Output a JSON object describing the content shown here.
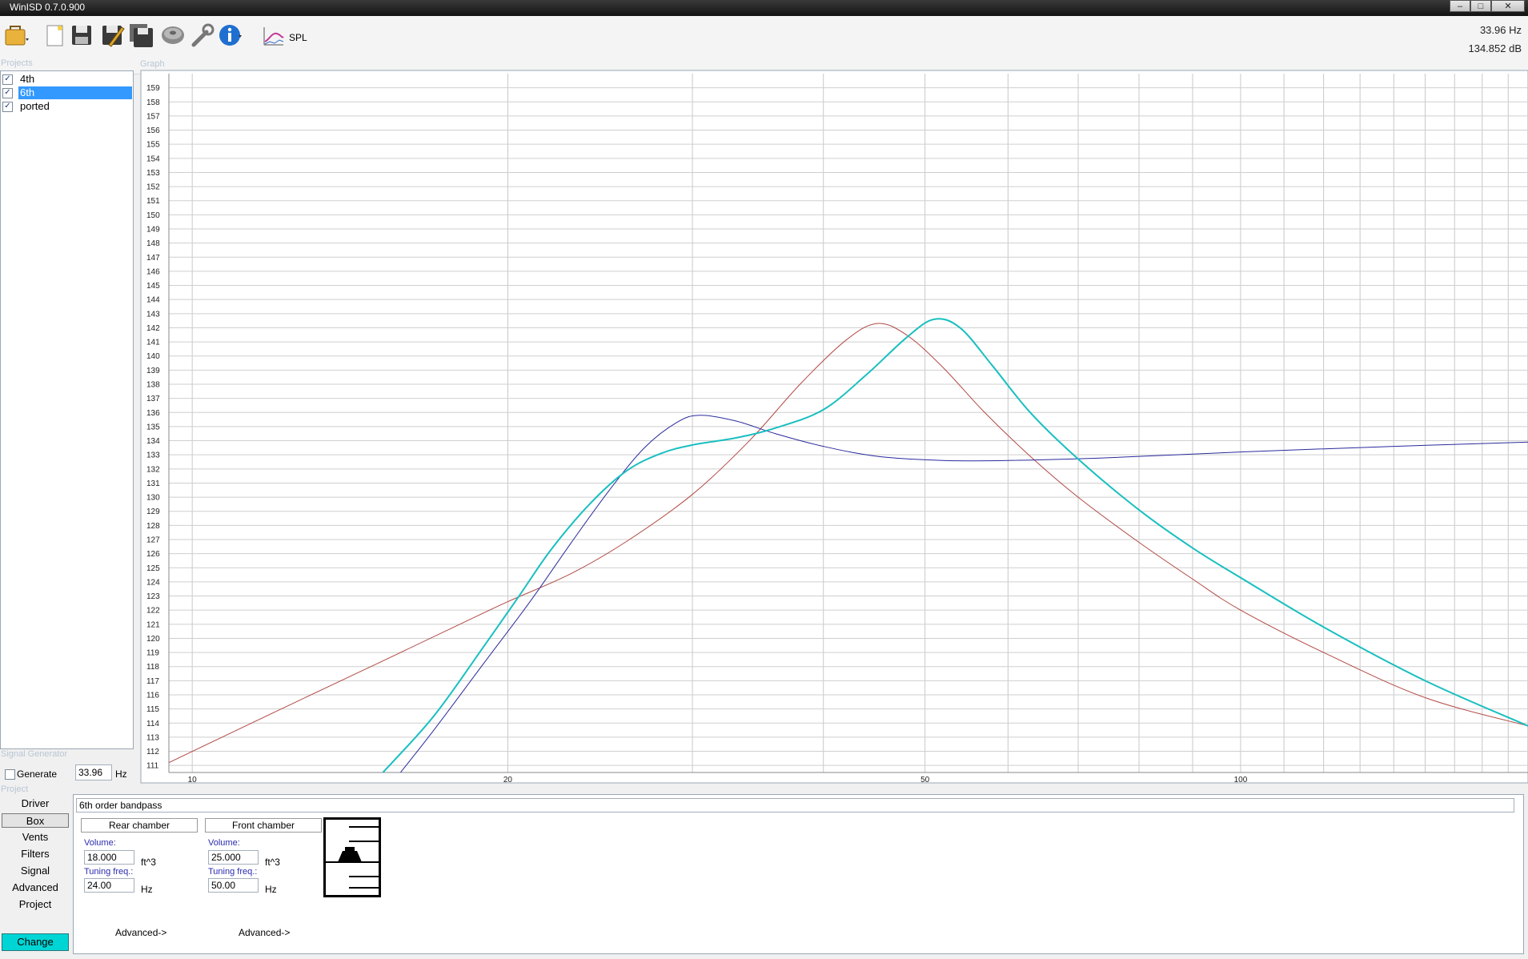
{
  "window": {
    "title": "WinISD 0.7.0.900",
    "minimize": "–",
    "maximize": "□",
    "close": "✕"
  },
  "toolbar": {
    "icons": [
      "open-folder-icon",
      "new-project-icon",
      "save-icon",
      "save-as-icon",
      "save-all-icon",
      "driver-icon",
      "tools-wrench-icon",
      "info-icon",
      "spl-graph-icon"
    ],
    "spl_label": "SPL",
    "readout_freq": "33.96 Hz",
    "readout_db": "134.852 dB"
  },
  "projects": {
    "header": "Projects",
    "items": [
      {
        "label": "4th",
        "checked": true,
        "selected": false
      },
      {
        "label": "6th",
        "checked": true,
        "selected": true
      },
      {
        "label": "ported",
        "checked": true,
        "selected": false
      }
    ]
  },
  "graph_header": "Graph",
  "signal_generator": {
    "header": "Signal Generator",
    "generate_label": "Generate",
    "generate_checked": false,
    "freq_value": "33.96",
    "unit": "Hz"
  },
  "project_section": {
    "header": "Project",
    "nav": [
      "Driver",
      "Box",
      "Vents",
      "Filters",
      "Signal",
      "Advanced",
      "Project"
    ],
    "selected_nav": "Box",
    "change_label": "Change",
    "box_description": "6th order bandpass",
    "rear": {
      "header": "Rear chamber",
      "volume_label": "Volume:",
      "volume": "18.000",
      "volume_unit": "ft^3",
      "tuning_label": "Tuning freq.:",
      "tuning": "24.00",
      "tuning_unit": "Hz",
      "advanced": "Advanced->"
    },
    "front": {
      "header": "Front chamber",
      "volume_label": "Volume:",
      "volume": "25.000",
      "volume_unit": "ft^3",
      "tuning_label": "Tuning freq.:",
      "tuning": "50.00",
      "tuning_unit": "Hz",
      "advanced": "Advanced->"
    }
  },
  "chart_data": {
    "type": "line",
    "xscale": "log",
    "xlim": [
      9.5,
      188
    ],
    "ylim": [
      110.5,
      160
    ],
    "x_ticks": [
      10,
      20,
      50,
      100
    ],
    "y_ticks": [
      111,
      112,
      113,
      114,
      115,
      116,
      117,
      118,
      119,
      120,
      121,
      122,
      123,
      124,
      125,
      126,
      127,
      128,
      129,
      130,
      131,
      132,
      133,
      134,
      135,
      136,
      137,
      138,
      139,
      140,
      141,
      142,
      143,
      144,
      145,
      146,
      147,
      148,
      149,
      150,
      151,
      152,
      153,
      154,
      155,
      156,
      157,
      158,
      159
    ],
    "grid": true,
    "series": [
      {
        "color": "#b24a45",
        "width": 1,
        "x": [
          9.5,
          12,
          15,
          18,
          20,
          23,
          26,
          30,
          34,
          38,
          42,
          45,
          48,
          52,
          57,
          63,
          70,
          80,
          90,
          100,
          120,
          150,
          188
        ],
        "y": [
          111.2,
          114.8,
          118.2,
          121.0,
          122.6,
          124.6,
          126.9,
          130.2,
          134.0,
          138.0,
          141.1,
          142.3,
          141.5,
          139.2,
          136.0,
          132.9,
          130.0,
          126.8,
          124.2,
          122.0,
          119.0,
          115.8,
          113.8
        ]
      },
      {
        "color": "#2a2a9c",
        "width": 1,
        "x": [
          15.8,
          17,
          19,
          21,
          23,
          25,
          27,
          29,
          30.5,
          33,
          36,
          40,
          45,
          52,
          60,
          75,
          100,
          140,
          188
        ],
        "y": [
          110.5,
          113.5,
          118.3,
          122.6,
          126.8,
          130.5,
          133.5,
          135.3,
          135.8,
          135.4,
          134.5,
          133.6,
          132.9,
          132.6,
          132.6,
          132.8,
          133.2,
          133.6,
          133.9
        ]
      },
      {
        "color": "#19bfc0",
        "width": 2,
        "x": [
          15.2,
          17,
          19,
          20.5,
          22,
          24,
          26,
          28,
          30,
          33,
          36,
          40,
          44,
          48,
          51,
          54,
          58,
          63,
          70,
          80,
          90,
          100,
          120,
          150,
          188
        ],
        "y": [
          110.5,
          114.5,
          119.5,
          123.0,
          126.3,
          129.6,
          131.9,
          133.1,
          133.7,
          134.2,
          134.9,
          136.2,
          138.7,
          141.3,
          142.6,
          142.0,
          139.3,
          136.0,
          132.7,
          129.1,
          126.4,
          124.3,
          120.8,
          117.0,
          113.8
        ]
      }
    ]
  }
}
